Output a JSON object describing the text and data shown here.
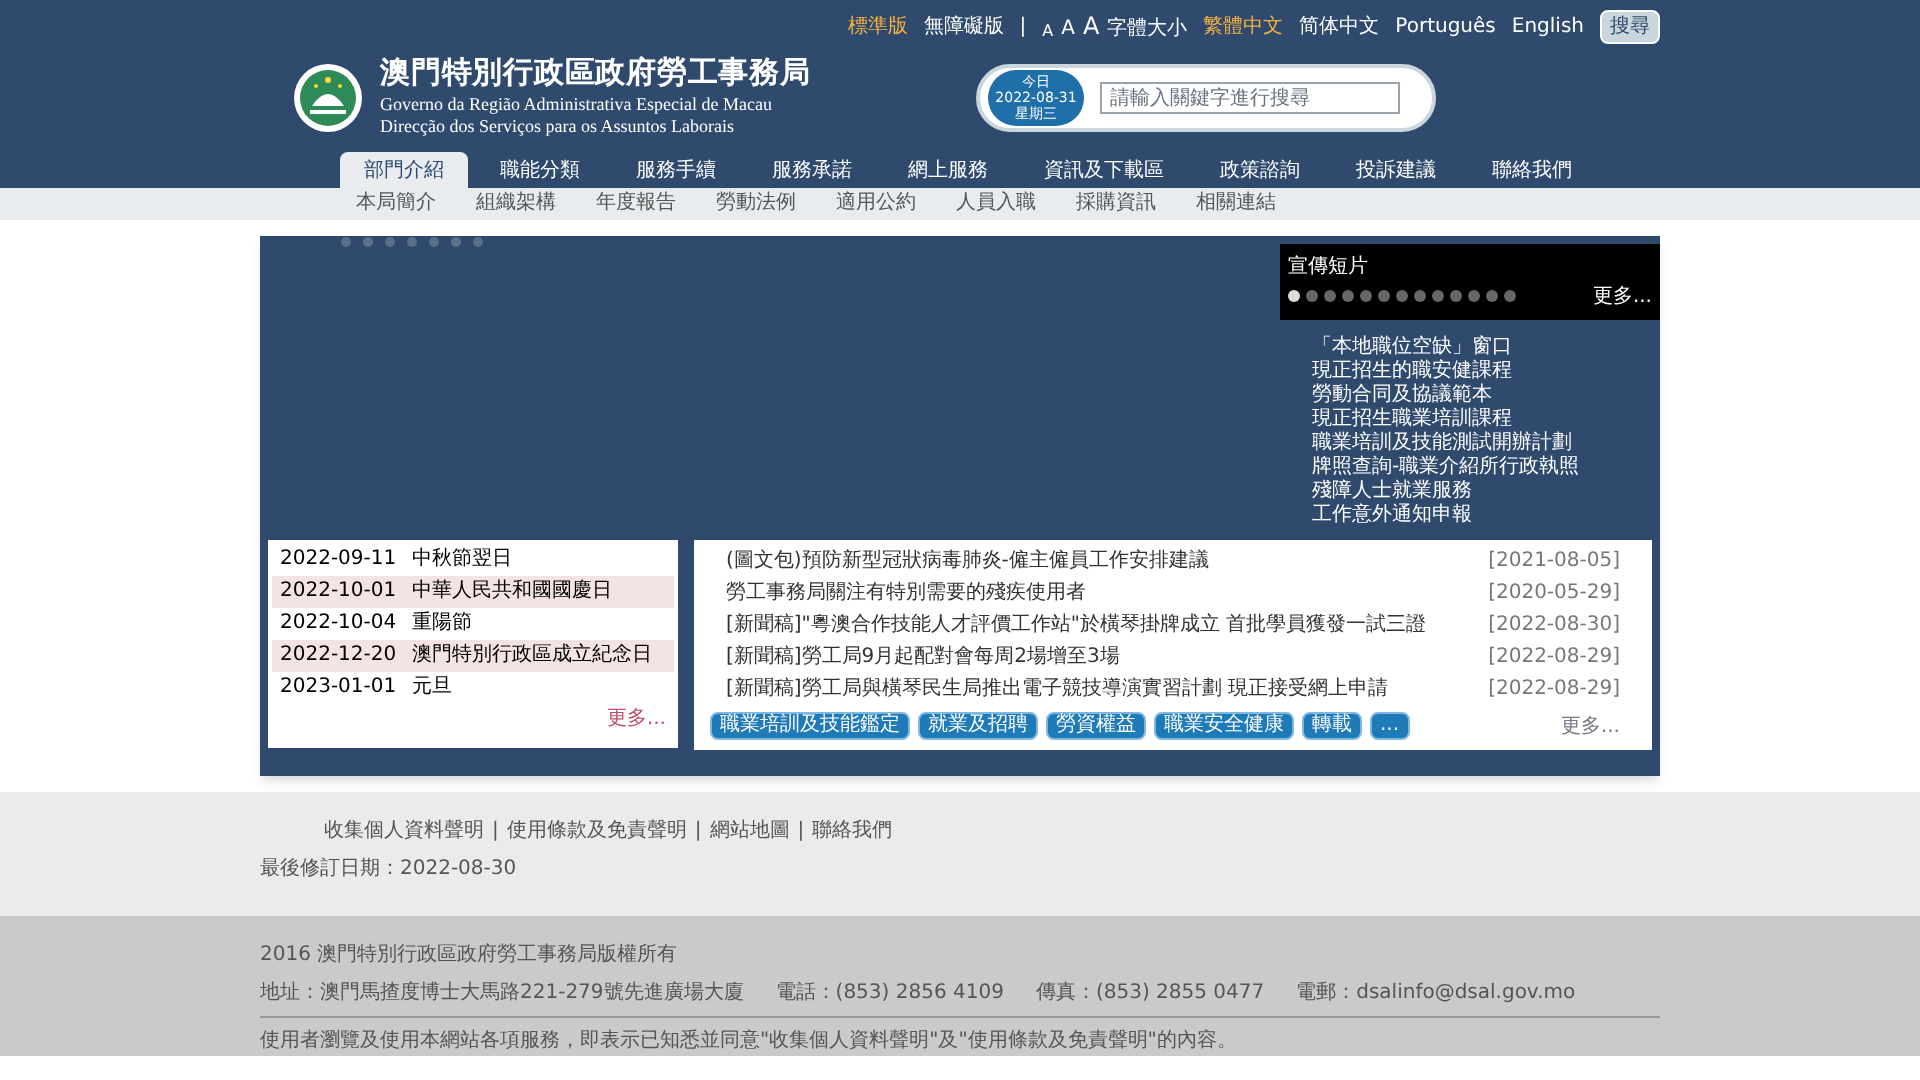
{
  "top_links": {
    "versions": [
      {
        "label": "標準版",
        "selected": true
      },
      {
        "label": "無障礙版",
        "selected": false
      }
    ],
    "separator": "|",
    "font_sizes": [
      "A",
      "A",
      "A"
    ],
    "font_size_label": "字體大小",
    "languages": [
      {
        "label": "繁體中文",
        "selected": true
      },
      {
        "label": "简体中文",
        "selected": false
      },
      {
        "label": "Português",
        "selected": false
      },
      {
        "label": "English",
        "selected": false
      }
    ],
    "search_button": "搜尋"
  },
  "header": {
    "title": "澳門特別行政區政府勞工事務局",
    "subtitle_1": "Governo da Região Administrativa Especial de Macau",
    "subtitle_2": "Direcção dos Serviços para os Assuntos Laborais",
    "today_label": "今日",
    "date": "2022-08-31",
    "weekday": "星期三",
    "search": {
      "placeholder": "請輸入關鍵字進行搜尋"
    }
  },
  "nav": [
    {
      "label": "部門介紹",
      "selected": true
    },
    {
      "label": "職能分類",
      "selected": false
    },
    {
      "label": "服務手續",
      "selected": false
    },
    {
      "label": "服務承諾",
      "selected": false
    },
    {
      "label": "網上服務",
      "selected": false
    },
    {
      "label": "資訊及下載區",
      "selected": false
    },
    {
      "label": "政策諮詢",
      "selected": false
    },
    {
      "label": "投訴建議",
      "selected": false
    },
    {
      "label": "聯絡我們",
      "selected": false
    }
  ],
  "subnav": [
    "本局簡介",
    "組織架構",
    "年度報告",
    "勞動法例",
    "適用公約",
    "人員入職",
    "採購資訊",
    "相關連結"
  ],
  "video_panel": {
    "title": "宣傳短片",
    "dots": [
      {
        "selected": true
      },
      {
        "selected": false
      },
      {
        "selected": false
      },
      {
        "selected": false
      },
      {
        "selected": false
      },
      {
        "selected": false
      },
      {
        "selected": false
      },
      {
        "selected": false
      },
      {
        "selected": false
      },
      {
        "selected": false
      },
      {
        "selected": false
      },
      {
        "selected": false
      },
      {
        "selected": false
      }
    ],
    "more": "更多..."
  },
  "quick_links": [
    "「本地職位空缺」窗口",
    "現正招生的職安健課程",
    "勞動合同及協議範本",
    "現正招生職業培訓課程",
    "職業培訓及技能測試開辦計劃",
    "牌照查詢-職業介紹所行政執照",
    "殘障人士就業服務",
    "工作意外通知申報"
  ],
  "holidays": {
    "items": [
      {
        "date": "2022-09-11",
        "name": "中秋節翌日"
      },
      {
        "date": "2022-10-01",
        "name": "中華人民共和國國慶日"
      },
      {
        "date": "2022-10-04",
        "name": "重陽節"
      },
      {
        "date": "2022-12-20",
        "name": "澳門特別行政區成立紀念日"
      },
      {
        "date": "2023-01-01",
        "name": "元旦"
      }
    ],
    "more": "更多..."
  },
  "news": {
    "items": [
      {
        "title": "(圖文包)預防新型冠狀病毒肺炎-僱主僱員工作安排建議",
        "date": "[2021-08-05]"
      },
      {
        "title": "勞工事務局關注有特別需要的殘疾使用者",
        "date": "[2020-05-29]"
      },
      {
        "title": "[新聞稿]\"粵澳合作技能人才評價工作站\"於橫琴掛牌成立 首批學員獲發一試三證",
        "date": "[2022-08-30]"
      },
      {
        "title": "[新聞稿]勞工局9月起配對會每周2場增至3場",
        "date": "[2022-08-29]"
      },
      {
        "title": "[新聞稿]勞工局與橫琴民生局推出電子競技導演實習計劃 現正接受網上申請",
        "date": "[2022-08-29]"
      }
    ],
    "tags": [
      "職業培訓及技能鑑定",
      "就業及招聘",
      "勞資權益",
      "職業安全健康",
      "轉載",
      "..."
    ],
    "more": "更多..."
  },
  "footer": {
    "separator": "|",
    "links": [
      "收集個人資料聲明",
      "使用條款及免責聲明",
      "網站地圖",
      "聯絡我們"
    ],
    "last_updated": "最後修訂日期：2022-08-30",
    "copyright": "2016 澳門特別行政區政府勞工事務局版權所有",
    "address": "地址：澳門馬揸度博士大馬路221-279號先進廣場大廈",
    "phone": "電話：(853) 2856 4109",
    "fax": "傳真：(853) 2855 0477",
    "email": "電郵：dsalinfo@dsal.gov.mo",
    "notice": "使用者瀏覽及使用本網站各項服務，即表示已知悉並同意\"收集個人資料聲明\"及\"使用條款及免責聲明\"的內容。"
  }
}
